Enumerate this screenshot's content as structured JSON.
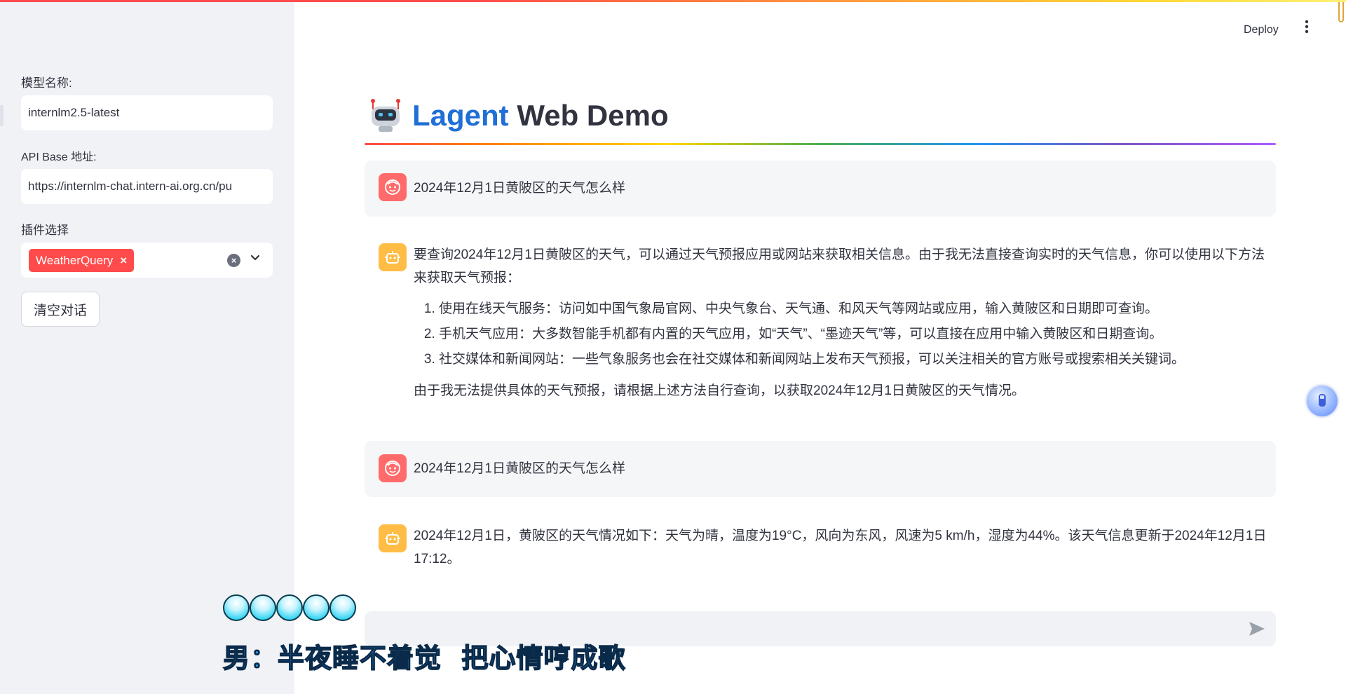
{
  "sidebar": {
    "model_label": "模型名称:",
    "model_value": "internlm2.5-latest",
    "api_label": "API Base 地址:",
    "api_value": "https://internlm-chat.intern-ai.org.cn/pu",
    "plugin_label": "插件选择",
    "plugin_tags": [
      {
        "label": "WeatherQuery",
        "remove": "×"
      }
    ],
    "clear_button": "清空对话"
  },
  "header": {
    "deploy_label": "Deploy",
    "menu_icon": "kebab-icon"
  },
  "title": {
    "accent": "Lagent",
    "rest": " Web Demo",
    "icon": "robot-icon",
    "accent_color": "#1f6fd6"
  },
  "messages": [
    {
      "role": "user",
      "text": "2024年12月1日黄陂区的天气怎么样"
    },
    {
      "role": "assistant",
      "intro": "要查询2024年12月1日黄陂区的天气，可以通过天气预报应用或网站来获取相关信息。由于我无法直接查询实时的天气信息，你可以使用以下方法来获取天气预报：",
      "items": [
        "使用在线天气服务：访问如中国气象局官网、中央气象台、天气通、和风天气等网站或应用，输入黄陂区和日期即可查询。",
        "手机天气应用：大多数智能手机都有内置的天气应用，如“天气”、“墨迹天气”等，可以直接在应用中输入黄陂区和日期查询。",
        "社交媒体和新闻网站：一些气象服务也会在社交媒体和新闻网站上发布天气预报，可以关注相关的官方账号或搜索相关关键词。"
      ],
      "outro": "由于我无法提供具体的天气预报，请根据上述方法自行查询，以获取2024年12月1日黄陂区的天气情况。"
    },
    {
      "role": "user",
      "text": "2024年12月1日黄陂区的天气怎么样"
    },
    {
      "role": "assistant",
      "text": "2024年12月1日，黄陂区的天气情况如下：天气为晴，温度为19°C，风向为东风，风速为5 km/h，湿度为44%。该天气信息更新于2024年12月1日17:12。"
    }
  ],
  "chat_input": {
    "placeholder": ""
  },
  "overlay": {
    "subtitle": "男：半夜睡不着觉  把心情哼成歌"
  },
  "colors": {
    "sidebar_bg": "#f0f2f6",
    "primary": "#ff4b4b",
    "user_avatar": "#ff6b6b",
    "bot_avatar": "#ffbd45"
  }
}
